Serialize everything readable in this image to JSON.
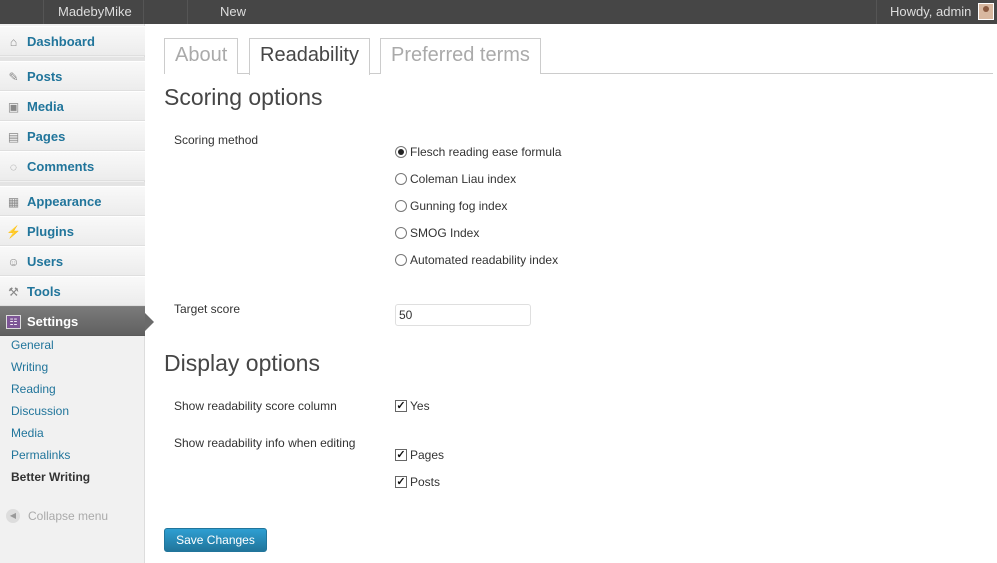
{
  "adminbar": {
    "site_name": "MadebyMike",
    "new_label": "New",
    "howdy": "Howdy, admin"
  },
  "sidebar": {
    "items": [
      {
        "label": "Dashboard",
        "icon": "dashboard-icon"
      },
      {
        "label": "Posts",
        "icon": "pin-icon"
      },
      {
        "label": "Media",
        "icon": "media-icon"
      },
      {
        "label": "Pages",
        "icon": "pages-icon"
      },
      {
        "label": "Comments",
        "icon": "comment-icon"
      },
      {
        "label": "Appearance",
        "icon": "appearance-icon"
      },
      {
        "label": "Plugins",
        "icon": "plug-icon"
      },
      {
        "label": "Users",
        "icon": "users-icon"
      },
      {
        "label": "Tools",
        "icon": "tools-icon"
      },
      {
        "label": "Settings",
        "icon": "settings-icon"
      }
    ],
    "submenu": [
      "General",
      "Writing",
      "Reading",
      "Discussion",
      "Media",
      "Permalinks",
      "Better Writing"
    ],
    "collapse_label": "Collapse menu"
  },
  "tabs": [
    "About",
    "Readability",
    "Preferred terms"
  ],
  "active_tab": "Readability",
  "scoring": {
    "heading": "Scoring options",
    "method_label": "Scoring method",
    "options": [
      "Flesch reading ease formula",
      "Coleman Liau index",
      "Gunning fog index",
      "SMOG Index",
      "Automated readability index"
    ],
    "selected": "Flesch reading ease formula",
    "target_label": "Target score",
    "target_value": "50"
  },
  "display": {
    "heading": "Display options",
    "column_label": "Show readability score column",
    "column_option": "Yes",
    "editing_label": "Show readability info when editing",
    "editing_options": [
      "Pages",
      "Posts"
    ]
  },
  "save_label": "Save Changes"
}
